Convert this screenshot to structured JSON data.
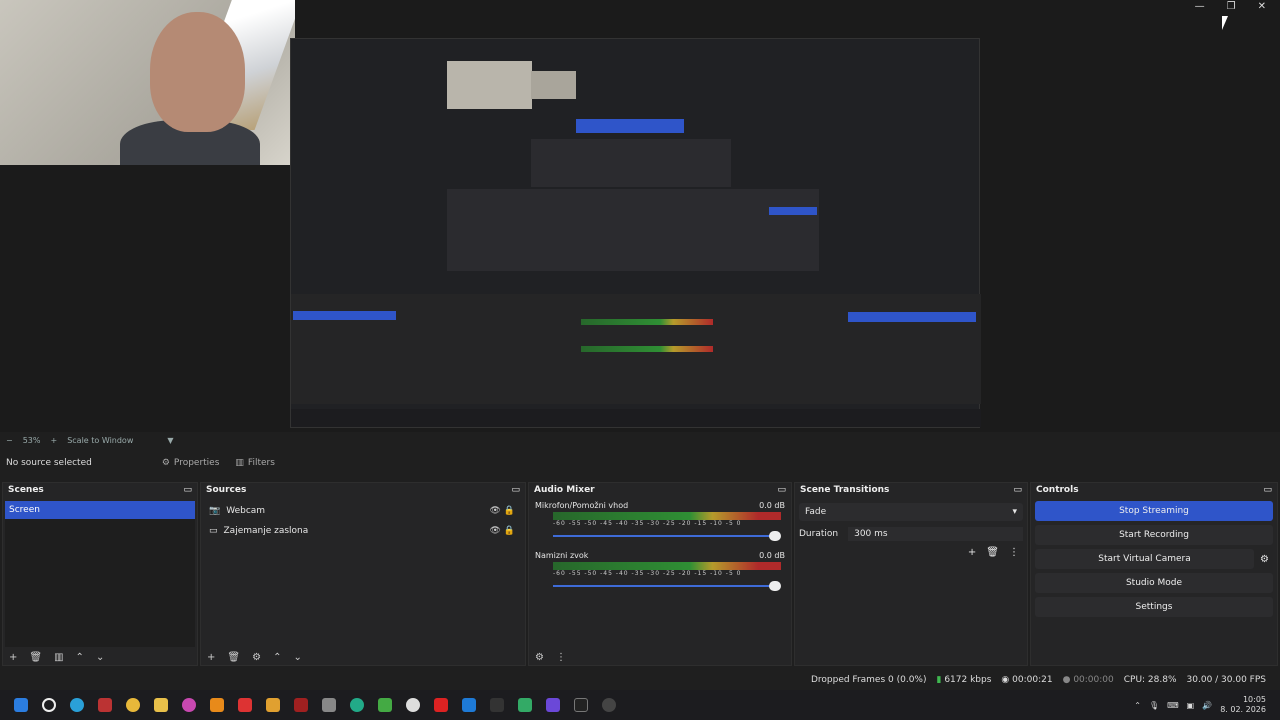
{
  "window_controls": {
    "min": "—",
    "max": "❐",
    "close": "✕"
  },
  "preview_bar": {
    "zoom": "53%",
    "scale": "Scale to Window"
  },
  "props_bar": {
    "no_source": "No source selected",
    "properties": "Properties",
    "filters": "Filters"
  },
  "scenes": {
    "title": "Scenes",
    "items": [
      "Screen"
    ]
  },
  "sources": {
    "title": "Sources",
    "items": [
      "Webcam",
      "Zajemanje zaslona"
    ]
  },
  "audio_mixer": {
    "title": "Audio Mixer",
    "channels": [
      {
        "name": "Mikrofon/Pomožni vhod",
        "db": "0.0 dB"
      },
      {
        "name": "Namizni zvok",
        "db": "0.0 dB"
      }
    ],
    "ticks": "-60 -55 -50 -45 -40 -35 -30 -25 -20 -15 -10 -5 0"
  },
  "transitions": {
    "title": "Scene Transitions",
    "selected": "Fade",
    "duration_label": "Duration",
    "duration_value": "300 ms"
  },
  "controls": {
    "title": "Controls",
    "buttons": [
      "Stop Streaming",
      "Start Recording",
      "Start Virtual Camera",
      "Studio Mode",
      "Settings"
    ]
  },
  "status": {
    "dropped": "Dropped Frames 0 (0.0%)",
    "kbps": "6172 kbps",
    "stream_time": "00:00:21",
    "rec_time": "00:00:00",
    "cpu": "CPU: 28.8%",
    "fps": "30.00 / 30.00 FPS"
  },
  "clock": {
    "time": "10:05",
    "date": "8. 02. 2026"
  },
  "colors": {
    "accent": "#2f55c9",
    "bg": "#1f1f1f"
  }
}
